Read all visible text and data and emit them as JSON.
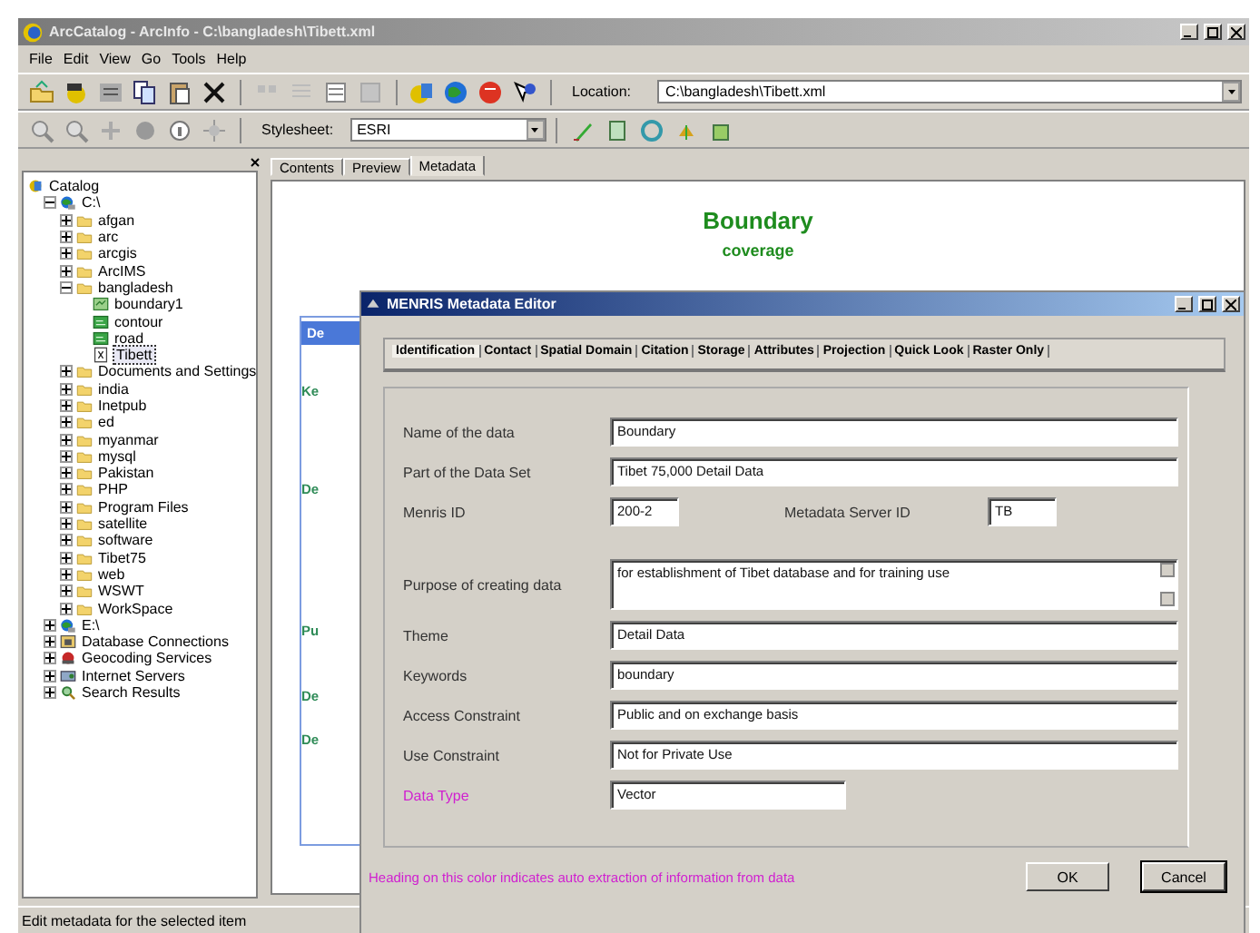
{
  "window": {
    "title": "ArcCatalog - ArcInfo - C:\\bangladesh\\Tibett.xml"
  },
  "menu": [
    "File",
    "Edit",
    "View",
    "Go",
    "Tools",
    "Help"
  ],
  "location": {
    "label": "Location:",
    "value": "C:\\bangladesh\\Tibett.xml"
  },
  "stylesheet": {
    "label": "Stylesheet:",
    "value": "ESRI"
  },
  "tree": [
    {
      "label": "Catalog",
      "kind": "catalog",
      "selected": false,
      "children": [
        {
          "label": "C:\\",
          "kind": "drive",
          "expanded": true,
          "selected": false,
          "children": [
            {
              "label": "afgan",
              "kind": "folder",
              "expanded": false,
              "selected": false
            },
            {
              "label": "arc",
              "kind": "folder",
              "expanded": false,
              "selected": false
            },
            {
              "label": "arcgis",
              "kind": "folder",
              "expanded": false,
              "selected": false
            },
            {
              "label": "ArcIMS",
              "kind": "folder",
              "expanded": false,
              "selected": false
            },
            {
              "label": "bangladesh",
              "kind": "folder",
              "expanded": true,
              "selected": false,
              "children": [
                {
                  "label": "boundary1",
                  "kind": "coverage",
                  "selected": false
                },
                {
                  "label": "contour",
                  "kind": "layer",
                  "selected": false
                },
                {
                  "label": "road",
                  "kind": "layer",
                  "selected": false
                },
                {
                  "label": "Tibett",
                  "kind": "xml",
                  "selected": true
                }
              ]
            },
            {
              "label": "Documents and Settings",
              "kind": "folder",
              "expanded": false,
              "selected": false
            },
            {
              "label": "india",
              "kind": "folder",
              "expanded": false,
              "selected": false
            },
            {
              "label": "Inetpub",
              "kind": "folder",
              "expanded": false,
              "selected": false
            },
            {
              "label": "ed",
              "kind": "folder",
              "expanded": false,
              "selected": false
            },
            {
              "label": "myanmar",
              "kind": "folder",
              "expanded": false,
              "selected": false
            },
            {
              "label": "mysql",
              "kind": "folder",
              "expanded": false,
              "selected": false
            },
            {
              "label": "Pakistan",
              "kind": "folder",
              "expanded": false,
              "selected": false
            },
            {
              "label": "PHP",
              "kind": "folder",
              "expanded": false,
              "selected": false
            },
            {
              "label": "Program Files",
              "kind": "folder",
              "expanded": false,
              "selected": false
            },
            {
              "label": "satellite",
              "kind": "folder",
              "expanded": false,
              "selected": false
            },
            {
              "label": "software",
              "kind": "folder",
              "expanded": false,
              "selected": false
            },
            {
              "label": "Tibet75",
              "kind": "folder",
              "expanded": false,
              "selected": false
            },
            {
              "label": "web",
              "kind": "folder",
              "expanded": false,
              "selected": false
            },
            {
              "label": "WSWT",
              "kind": "folder",
              "expanded": false,
              "selected": false
            },
            {
              "label": "WorkSpace",
              "kind": "folder",
              "expanded": false,
              "selected": false
            }
          ]
        },
        {
          "label": "E:\\",
          "kind": "drive",
          "expanded": false,
          "selected": false
        },
        {
          "label": "Database Connections",
          "kind": "database",
          "expanded": false,
          "selected": false
        },
        {
          "label": "Geocoding Services",
          "kind": "geocode",
          "expanded": false,
          "selected": false
        },
        {
          "label": "Internet Servers",
          "kind": "server",
          "expanded": false,
          "selected": false
        },
        {
          "label": "Search Results",
          "kind": "search",
          "expanded": false,
          "selected": false
        }
      ]
    }
  ],
  "view_tabs": [
    {
      "label": "Contents",
      "selected": false
    },
    {
      "label": "Preview",
      "selected": false
    },
    {
      "label": "Metadata",
      "selected": true
    }
  ],
  "metadata": {
    "title": "Boundary",
    "subtitle": "coverage",
    "fragments": [
      "De",
      "Ke",
      "De",
      "Pu",
      "De",
      "De"
    ]
  },
  "dialog": {
    "title": "MENRIS Metadata Editor",
    "tabs": [
      {
        "label": "Identification",
        "selected": true
      },
      {
        "label": "Contact",
        "selected": false
      },
      {
        "label": "Spatial Domain",
        "selected": false
      },
      {
        "label": "Citation",
        "selected": false
      },
      {
        "label": "Storage",
        "selected": false
      },
      {
        "label": "Attributes",
        "selected": false
      },
      {
        "label": "Projection",
        "selected": false
      },
      {
        "label": "Quick Look",
        "selected": false
      },
      {
        "label": "Raster Only",
        "selected": false
      }
    ],
    "rows": [
      [
        {
          "label": "Name of the data",
          "value": "Boundary",
          "kind": "wide",
          "auto": false
        }
      ],
      [
        {
          "label": "Part of the Data Set",
          "value": "Tibet 75,000 Detail Data",
          "kind": "wide",
          "auto": false
        }
      ],
      [
        {
          "label": "Menris ID",
          "value": "200-2",
          "kind": "short",
          "auto": false
        },
        {
          "label": "Metadata Server ID",
          "value": "TB",
          "kind": "short",
          "auto": false
        }
      ],
      [
        {
          "label": "Purpose of creating data",
          "value": "for establishment of Tibet database and for training use",
          "kind": "memo",
          "auto": false
        }
      ],
      [
        {
          "label": "Theme",
          "value": "Detail Data",
          "kind": "wide",
          "auto": false
        }
      ],
      [
        {
          "label": "Keywords",
          "value": "boundary",
          "kind": "wide",
          "auto": false
        }
      ],
      [
        {
          "label": "Access Constraint",
          "value": "Public and on exchange basis",
          "kind": "wide",
          "auto": false
        }
      ],
      [
        {
          "label": "Use Constraint",
          "value": "Not for Private Use",
          "kind": "wide",
          "auto": false
        }
      ],
      [
        {
          "label": "Data Type",
          "value": "Vector",
          "kind": "medium",
          "auto": true
        }
      ]
    ],
    "note": "Heading on this color indicates auto extraction of information from data",
    "buttons": [
      "OK",
      "Cancel"
    ]
  },
  "status_bar": "Edit metadata for the selected item"
}
